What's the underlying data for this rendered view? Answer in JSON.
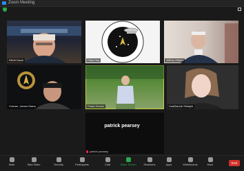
{
  "window": {
    "title": "Zoom Meeting"
  },
  "participants": [
    {
      "name": "Elliott Davis"
    },
    {
      "name": "Hoky Hay"
    },
    {
      "name": "Jeffrey Gilbert"
    },
    {
      "name": "Cramer, James Diana"
    },
    {
      "name": "Paula Genuis"
    },
    {
      "name": "LisaDianne Straight"
    }
  ],
  "speaker": {
    "name": "patrick pearsey",
    "label": "patrick pearsey"
  },
  "toolbar": {
    "items": [
      "Mute",
      "Start Video",
      "Security",
      "Participants",
      "Chat",
      "Share Screen",
      "Reactions",
      "Apps",
      "Whiteboards",
      "More"
    ],
    "end_label": "End"
  },
  "colors": {
    "active_border": "#c6d13a",
    "share": "#2ca84a",
    "end": "#d3312a"
  }
}
